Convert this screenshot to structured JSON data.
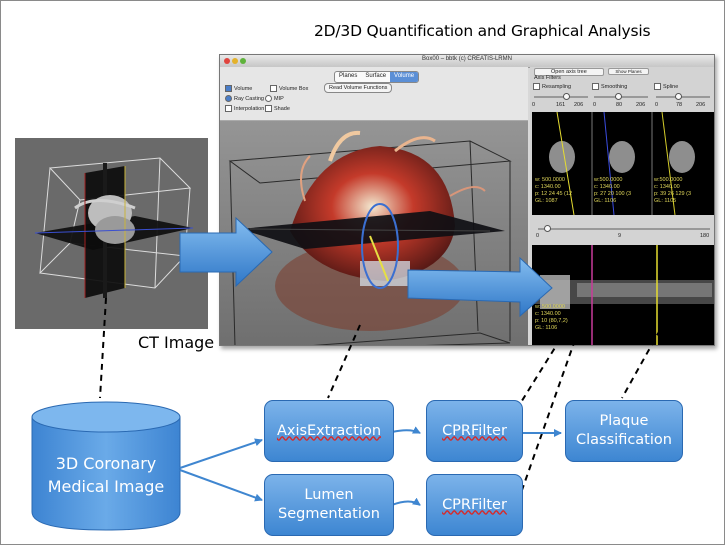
{
  "title": "2D/3D Quantification and Graphical Analysis",
  "ct_label": "CT Image",
  "window": {
    "title": "Box00 – bbtk (c) CREATIS-LRMN",
    "tabs": [
      "Planes",
      "Surface",
      "Volume"
    ],
    "active_tab": "Volume",
    "options": {
      "volume": "Volume",
      "volume_box": "Volume Box",
      "ray_casting": "Ray Casting",
      "mip": "MIP",
      "interpolation": "Interpolation",
      "shade": "Shade",
      "read_button": "Read Volume Functions"
    },
    "right_panel": {
      "open_tab": "Open axis tree",
      "show_tab": "Show Planes",
      "axis_filters": "Axis Filters",
      "filters": [
        "Resampling",
        "Smoothing",
        "Spline"
      ],
      "slider_values": [
        [
          "0",
          "161",
          "206"
        ],
        [
          "0",
          "80",
          "206"
        ],
        [
          "0",
          "78",
          "206"
        ]
      ],
      "slices": [
        {
          "w": "w: 500.0000",
          "c": "c: 1340.00",
          "p": "p: 12 24 45 (12",
          "gl": "GL: 1087"
        },
        {
          "w": "w:500.0000",
          "c": "c: 1340.00",
          "p": "p: 27 20 100 (3",
          "gl": "GL: 1106"
        },
        {
          "w": "w:500.0000",
          "c": "c: 1340.00",
          "p": "p: 39 26 129 (3",
          "gl": "GL: 1105"
        }
      ],
      "lower_slider": [
        "0",
        "9",
        "180"
      ],
      "cpr_text": {
        "w": "w: 500.0000",
        "c": "c: 1340.00",
        "p": "p: 10 (80,7,2)",
        "gl": "GL: 1106"
      }
    }
  },
  "flow": {
    "source": "3D Coronary Medical Image",
    "source_lines": [
      "3D Coronary",
      "Medical Image"
    ],
    "axis_extraction": "AxisExtraction",
    "cpr_filter_top": "CPRFilter",
    "lumen_segmentation_lines": [
      "Lumen",
      "Segmentation"
    ],
    "cpr_filter_bottom": "CPRFilter",
    "plaque_lines": [
      "Plaque",
      "Classification"
    ]
  },
  "colors": {
    "box_fill": "#4a8fd8",
    "box_border": "#2a69b2",
    "arrow": "#3f86d0",
    "cylinder": "#4a90d9"
  }
}
